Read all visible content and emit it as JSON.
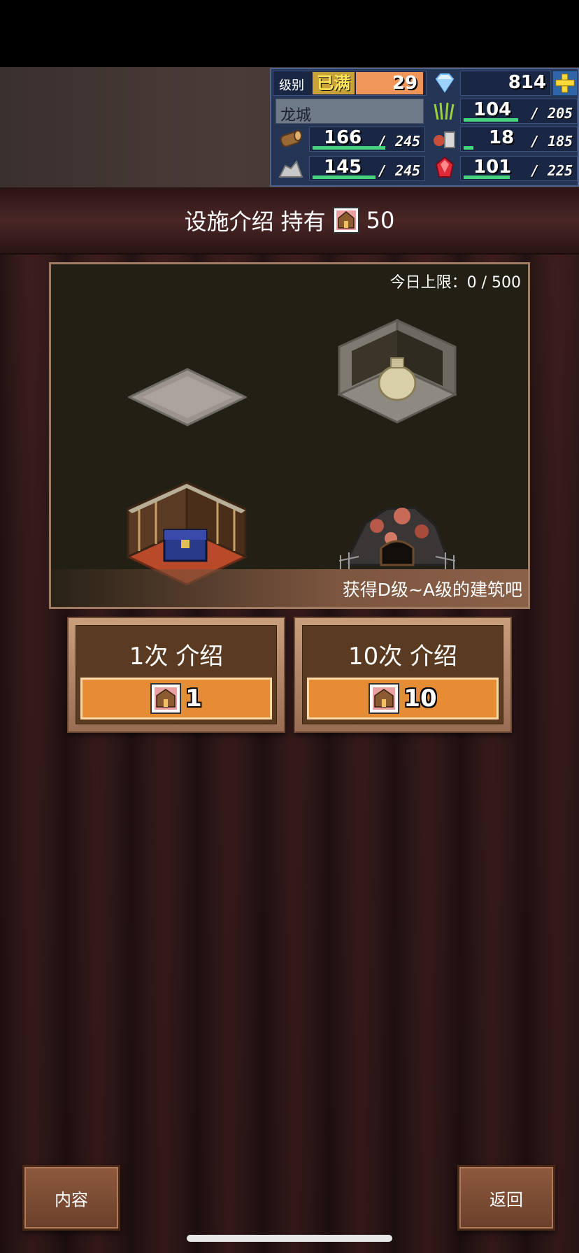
{
  "status": {
    "level_label": "级别",
    "level_state": "已满",
    "level_value": "29",
    "gems": "814",
    "town_name": "龙城",
    "resources": [
      {
        "icon": "grass-icon",
        "value": "104",
        "max": "205",
        "fill": 0.51
      },
      {
        "icon": "wood-log-icon",
        "value": "166",
        "max": "245",
        "fill": 0.68
      },
      {
        "icon": "food-icon",
        "value": "18",
        "max": "185",
        "fill": 0.1
      },
      {
        "icon": "ore-icon",
        "value": "145",
        "max": "245",
        "fill": 0.59
      },
      {
        "icon": "ruby-icon",
        "value": "101",
        "max": "225",
        "fill": 0.45
      }
    ]
  },
  "header": {
    "title": "设施介绍",
    "held_label": "持有",
    "held_count": "50"
  },
  "preview": {
    "daily_limit": "今日上限：0 / 500",
    "caption": "获得D级~A级的建筑吧"
  },
  "actions": [
    {
      "label": "1次 介绍",
      "cost": "1"
    },
    {
      "label": "10次 介绍",
      "cost": "10"
    }
  ],
  "bottom": {
    "details_label": "内容",
    "back_label": "返回"
  },
  "colors": {
    "accent": "#e58c35",
    "panel": "#253556",
    "bar": "#46d27f"
  }
}
